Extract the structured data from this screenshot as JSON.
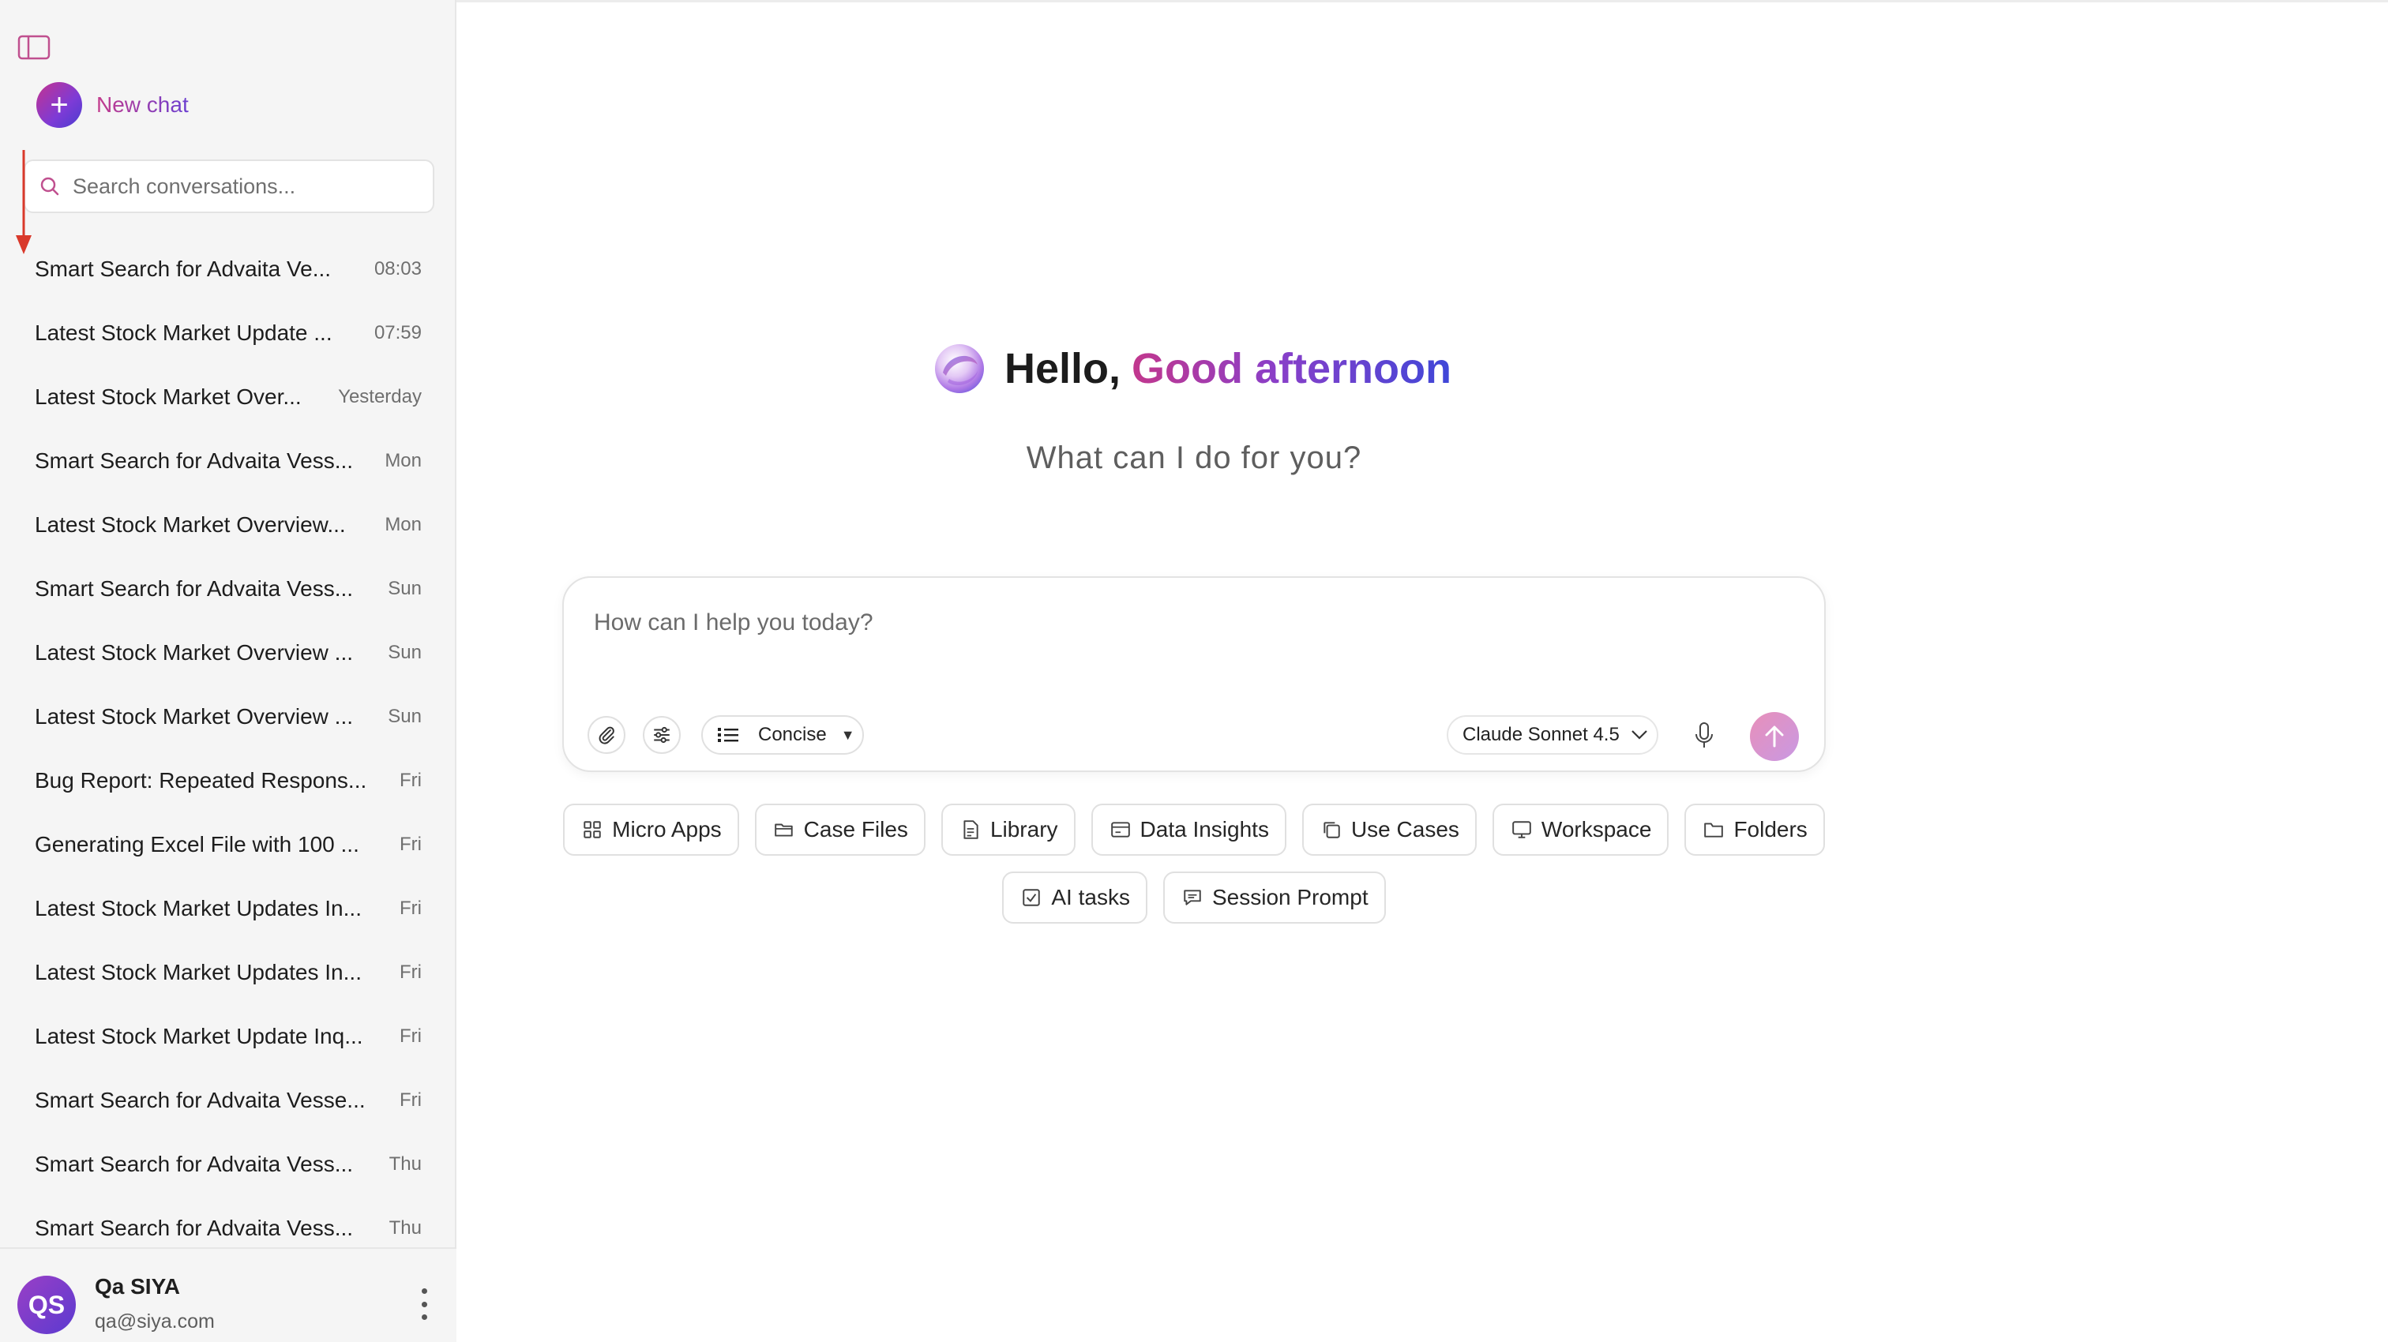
{
  "sidebar": {
    "new_chat_label": "New chat",
    "search_placeholder": "Search conversations...",
    "conversations": [
      {
        "title": "Smart Search for Advaita Ve...",
        "time": "08:03"
      },
      {
        "title": "Latest Stock Market Update ...",
        "time": "07:59"
      },
      {
        "title": "Latest Stock Market Over...",
        "time": "Yesterday"
      },
      {
        "title": "Smart Search for Advaita Vess...",
        "time": "Mon"
      },
      {
        "title": "Latest Stock Market Overview...",
        "time": "Mon"
      },
      {
        "title": "Smart Search for Advaita Vess...",
        "time": "Sun"
      },
      {
        "title": "Latest Stock Market Overview ...",
        "time": "Sun"
      },
      {
        "title": "Latest Stock Market Overview ...",
        "time": "Sun"
      },
      {
        "title": "Bug Report: Repeated Respons...",
        "time": "Fri"
      },
      {
        "title": "Generating Excel File with 100 ...",
        "time": "Fri"
      },
      {
        "title": "Latest Stock Market Updates In...",
        "time": "Fri"
      },
      {
        "title": "Latest Stock Market Updates In...",
        "time": "Fri"
      },
      {
        "title": "Latest Stock Market Update Inq...",
        "time": "Fri"
      },
      {
        "title": "Smart Search for Advaita Vesse...",
        "time": "Fri"
      },
      {
        "title": "Smart Search for Advaita Vess...",
        "time": "Thu"
      },
      {
        "title": "Smart Search for Advaita Vess...",
        "time": "Thu"
      }
    ],
    "user": {
      "initials": "QS",
      "name": "Qa SIYA",
      "email": "qa@siya.com"
    }
  },
  "main": {
    "greeting_hello": "Hello,",
    "greeting_rest": "Good afternoon",
    "subtitle": "What can I do for you?",
    "composer": {
      "placeholder": "How can I help you today?",
      "mode_label": "Concise",
      "model_label": "Claude Sonnet 4.5"
    },
    "chips_row1": [
      {
        "label": "Micro Apps",
        "icon": "grid-icon"
      },
      {
        "label": "Case Files",
        "icon": "folder-open-icon"
      },
      {
        "label": "Library",
        "icon": "document-icon"
      },
      {
        "label": "Data Insights",
        "icon": "card-icon"
      },
      {
        "label": "Use Cases",
        "icon": "copy-icon"
      },
      {
        "label": "Workspace",
        "icon": "monitor-icon"
      },
      {
        "label": "Folders",
        "icon": "folder-icon"
      }
    ],
    "chips_row2": [
      {
        "label": "AI tasks",
        "icon": "checkbox-icon"
      },
      {
        "label": "Session Prompt",
        "icon": "message-icon"
      }
    ]
  },
  "colors": {
    "accent_pink": "#c4338f",
    "accent_purple": "#7d3bd6",
    "accent_blue": "#3f47d8",
    "annotation_arrow": "#d9392b"
  }
}
